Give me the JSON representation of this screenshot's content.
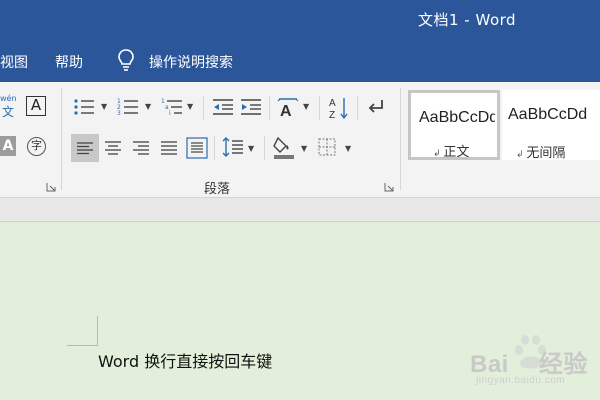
{
  "titlebar": {
    "title": "文档1  -  Word"
  },
  "menu": {
    "tabs": [
      {
        "label": "视图"
      },
      {
        "label": "帮助"
      }
    ],
    "search_label": "操作说明搜索"
  },
  "ribbon": {
    "font_group": {
      "pinyin_top": "wén",
      "pinyin_bottom": "文",
      "char_border": "A",
      "char_shading": "A",
      "enclose_char": "字"
    },
    "paragraph_group": {
      "label": "段落"
    },
    "styles": [
      {
        "sample": "AaBbCcDd",
        "name": "正文",
        "selected": true
      },
      {
        "sample": "AaBbCcDd",
        "name": "无间隔",
        "selected": false
      }
    ]
  },
  "document": {
    "text": "Word 换行直接按回车键"
  },
  "watermark": {
    "brand": "Bai",
    "brand2": "经验",
    "url": "jingyan.baidu.com"
  },
  "colors": {
    "titlebar": "#2b579a",
    "ribbon": "#f3f3f3",
    "document_bg": "#e2efdb"
  }
}
